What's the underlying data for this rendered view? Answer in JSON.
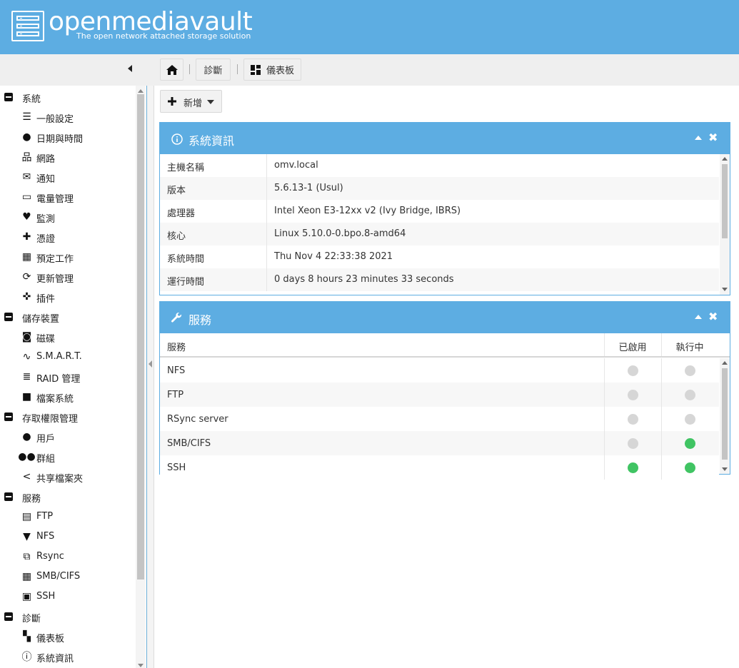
{
  "app": {
    "name": "openmediavault",
    "tagline": "The open network attached storage solution"
  },
  "breadcrumb": {
    "home_icon": "home-icon",
    "items": [
      {
        "label": "診斷"
      },
      {
        "label": "儀表板",
        "icon": "dashboard-icon"
      }
    ]
  },
  "toolbar": {
    "add_label": "新增"
  },
  "sidebar": {
    "groups": [
      {
        "label": "系統",
        "items": [
          {
            "label": "一般設定",
            "icon": "sliders-icon"
          },
          {
            "label": "日期與時間",
            "icon": "clock-icon"
          },
          {
            "label": "網路",
            "icon": "network-icon"
          },
          {
            "label": "通知",
            "icon": "mail-icon"
          },
          {
            "label": "電量管理",
            "icon": "battery-icon"
          },
          {
            "label": "監測",
            "icon": "heartbeat-icon"
          },
          {
            "label": "憑證",
            "icon": "certificate-icon"
          },
          {
            "label": "預定工作",
            "icon": "calendar-clock-icon"
          },
          {
            "label": "更新管理",
            "icon": "refresh-icon"
          },
          {
            "label": "插件",
            "icon": "puzzle-icon"
          }
        ]
      },
      {
        "label": "儲存裝置",
        "items": [
          {
            "label": "磁碟",
            "icon": "disk-icon"
          },
          {
            "label": "S.M.A.R.T.",
            "icon": "pulse-icon"
          },
          {
            "label": "RAID 管理",
            "icon": "database-icon"
          },
          {
            "label": "檔案系統",
            "icon": "folder-icon"
          }
        ]
      },
      {
        "label": "存取權限管理",
        "items": [
          {
            "label": "用戶",
            "icon": "user-icon"
          },
          {
            "label": "群組",
            "icon": "users-icon"
          },
          {
            "label": "共享檔案夾",
            "icon": "share-icon"
          }
        ]
      },
      {
        "label": "服務",
        "items": [
          {
            "label": "FTP",
            "icon": "server-icon"
          },
          {
            "label": "NFS",
            "icon": "nfs-icon"
          },
          {
            "label": "Rsync",
            "icon": "rsync-icon"
          },
          {
            "label": "SMB/CIFS",
            "icon": "windows-icon"
          },
          {
            "label": "SSH",
            "icon": "terminal-icon"
          }
        ]
      },
      {
        "label": "診斷",
        "items": [
          {
            "label": "儀表板",
            "icon": "dashboard-icon"
          },
          {
            "label": "系統資訊",
            "icon": "info-icon"
          }
        ]
      }
    ]
  },
  "sysinfo": {
    "title": "系統資訊",
    "rows": [
      {
        "key": "主機名稱",
        "value": "omv.local"
      },
      {
        "key": "版本",
        "value": "5.6.13-1 (Usul)"
      },
      {
        "key": "處理器",
        "value": "Intel Xeon E3-12xx v2 (Ivy Bridge, IBRS)"
      },
      {
        "key": "核心",
        "value": "Linux 5.10.0-0.bpo.8-amd64"
      },
      {
        "key": "系統時間",
        "value": "Thu Nov 4 22:33:38 2021"
      },
      {
        "key": "運行時間",
        "value": "0 days 8 hours 23 minutes 33 seconds"
      }
    ]
  },
  "services": {
    "title": "服務",
    "columns": [
      "服務",
      "已啟用",
      "執行中"
    ],
    "rows": [
      {
        "name": "NFS",
        "enabled": false,
        "running": false
      },
      {
        "name": "FTP",
        "enabled": false,
        "running": false
      },
      {
        "name": "RSync server",
        "enabled": false,
        "running": false
      },
      {
        "name": "SMB/CIFS",
        "enabled": false,
        "running": true
      },
      {
        "name": "SSH",
        "enabled": true,
        "running": true
      }
    ]
  },
  "colors": {
    "header": "#5dade2",
    "enabled_dot": "#40c463",
    "disabled_dot": "#d6d6d6"
  }
}
